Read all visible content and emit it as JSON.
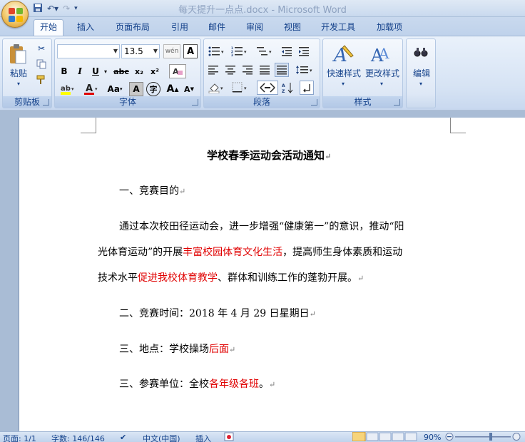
{
  "window": {
    "title": "每天提升一点点.docx - Microsoft Word"
  },
  "tabs": [
    "开始",
    "插入",
    "页面布局",
    "引用",
    "邮件",
    "审阅",
    "视图",
    "开发工具",
    "加载项"
  ],
  "ribbon": {
    "clipboard": {
      "paste": "粘贴",
      "label": "剪贴板"
    },
    "font": {
      "font_name": "",
      "font_size": "13.5",
      "label": "字体",
      "wen": "wén\n文",
      "A": "A",
      "bold": "B",
      "italic": "I",
      "underline": "U",
      "strike": "abc",
      "sub": "x₂",
      "sup": "x²",
      "case": "Aa",
      "charshade": "A",
      "grow": "A",
      "shrink": "A",
      "enclose": "字"
    },
    "paragraph": {
      "label": "段落"
    },
    "styles": {
      "quick": "快速样式",
      "change": "更改样式",
      "label": "样式"
    },
    "editing": {
      "label": "编辑"
    }
  },
  "document": {
    "title": "学校春季运动会活动通知",
    "h1": "一、竞赛目的",
    "p1_l1": "通过本次校田径运动会，进一步增强“健康第一”的意识，推动“阳",
    "p1_l2a": "光体育运动”的开展",
    "p1_l2b": "丰富校园体育文化生活",
    "p1_l2c": "，提高师生身体素质和运动",
    "p1_l3a": "技术水平",
    "p1_l3b": "促进我校体育教学",
    "p1_l3c": "、群体和训练工作的蓬勃开展。",
    "time": "二、竞赛时间：2018 年 4 月 29 日星期日",
    "place_a": "三、地点：学校操场",
    "place_b": "后面",
    "units_a": "三、参赛单位：全校",
    "units_b": "各年级各班",
    "units_c": "。",
    "mark": "↵"
  },
  "status": {
    "page": "页面: 1/1",
    "words": "字数: 146/146",
    "lang": "中文(中国)",
    "mode": "插入",
    "zoom": "90%"
  },
  "colors": {
    "accent": "#15428b",
    "red_text": "#e00000"
  }
}
